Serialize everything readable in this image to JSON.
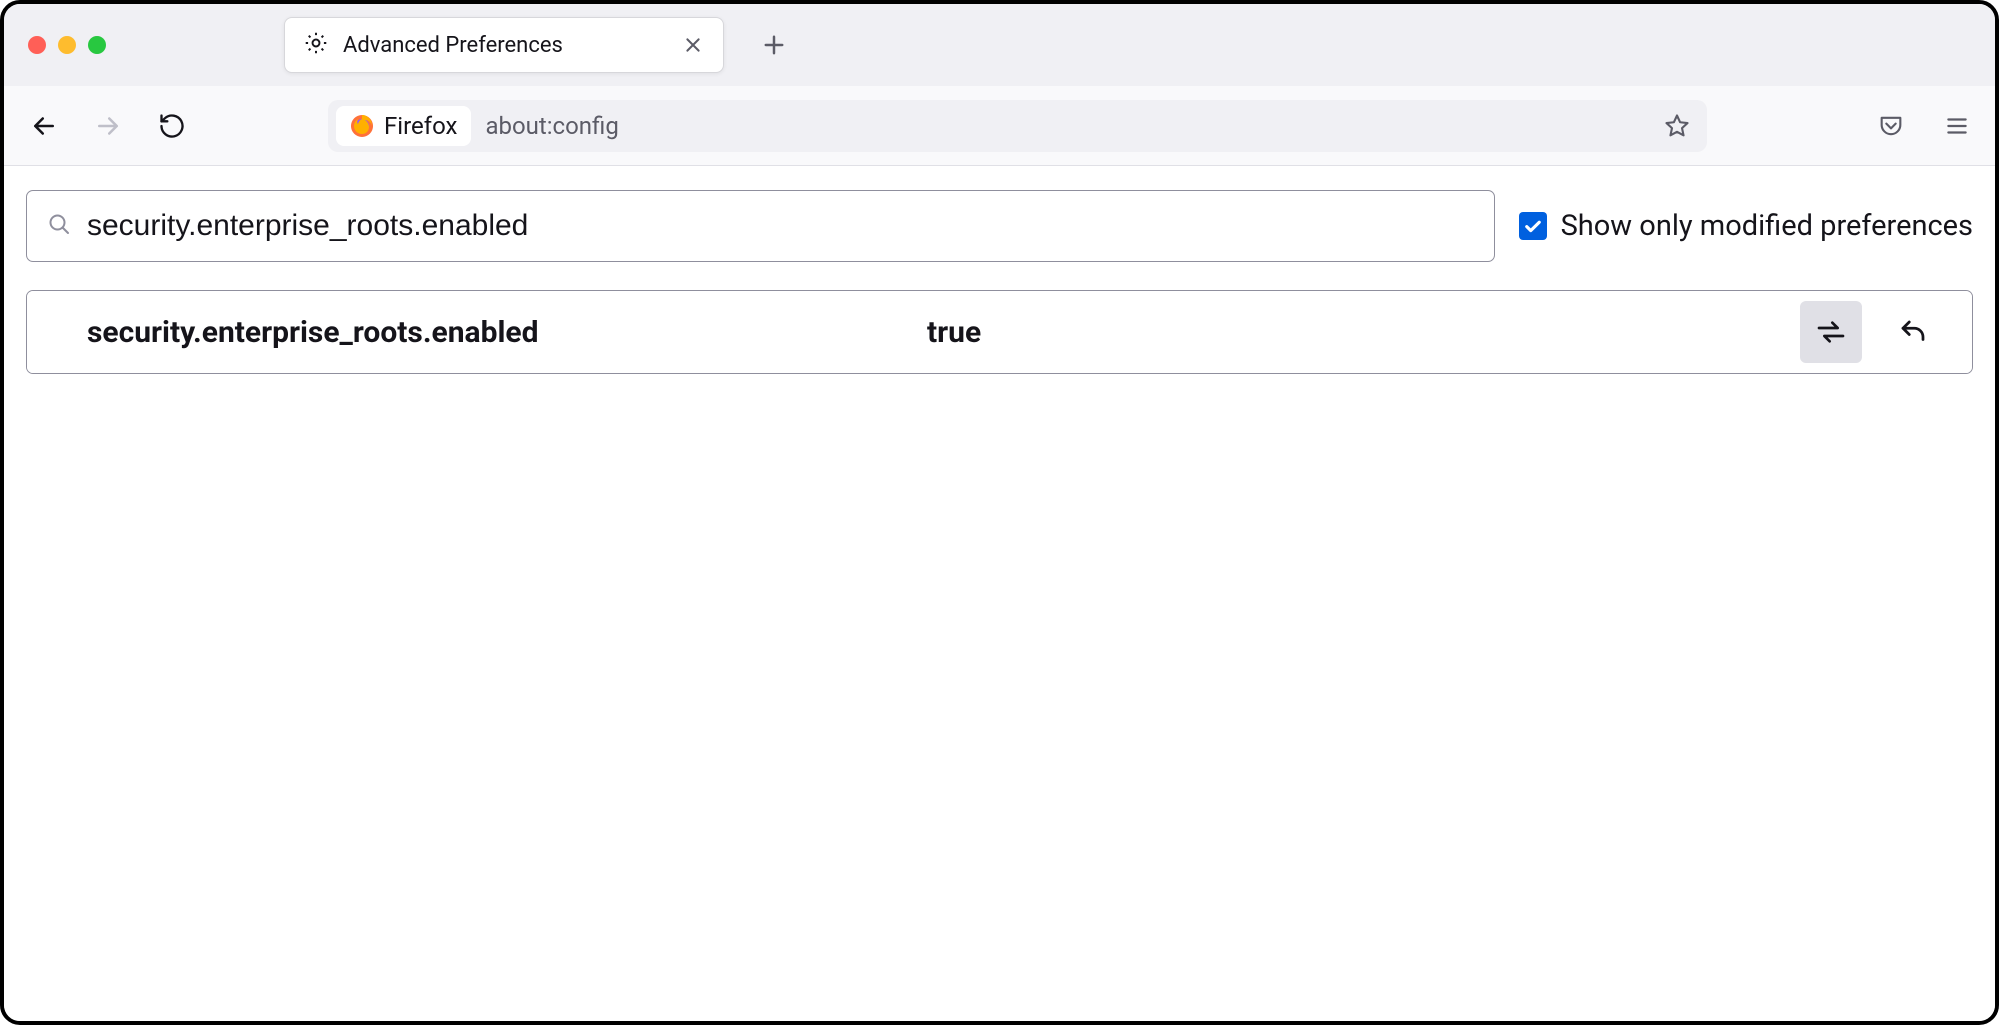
{
  "window": {
    "tab": {
      "title": "Advanced Preferences"
    }
  },
  "urlbar": {
    "identity_label": "Firefox",
    "url": "about:config"
  },
  "config": {
    "search_value": "security.enterprise_roots.enabled",
    "filter_label": "Show only modified preferences",
    "filter_checked": true,
    "rows": [
      {
        "name": "security.enterprise_roots.enabled",
        "value": "true"
      }
    ]
  }
}
